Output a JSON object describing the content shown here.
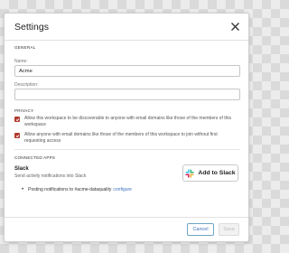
{
  "modal": {
    "title": "Settings"
  },
  "general": {
    "section_label": "GENERAL",
    "name_label": "Name:",
    "name_value": "Acme",
    "description_label": "Description:",
    "description_value": ""
  },
  "privacy": {
    "section_label": "PRIVACY",
    "options": [
      {
        "label": "Allow this workspace to be discoverable to anyone with email domains like those of the members of this workspace",
        "checked": true
      },
      {
        "label": "Allow anyone with email domains like those of the members of this workspace to join without first requesting access",
        "checked": true
      }
    ]
  },
  "connected_apps": {
    "section_label": "CONNECTED APPS",
    "slack": {
      "title": "Slack",
      "description": "Send activity notifications into Slack",
      "add_button_label": "Add to Slack",
      "notification_text": "Posting notifications to #acme-dataquality",
      "configure_label": "configure"
    }
  },
  "footer": {
    "cancel_label": "Cancel",
    "save_label": "Save"
  },
  "colors": {
    "checkbox": "#b03a2e",
    "link": "#3b73b9"
  },
  "icons": [
    "close-icon",
    "checkmark-icon",
    "slack-logo-icon",
    "bullet-icon"
  ]
}
